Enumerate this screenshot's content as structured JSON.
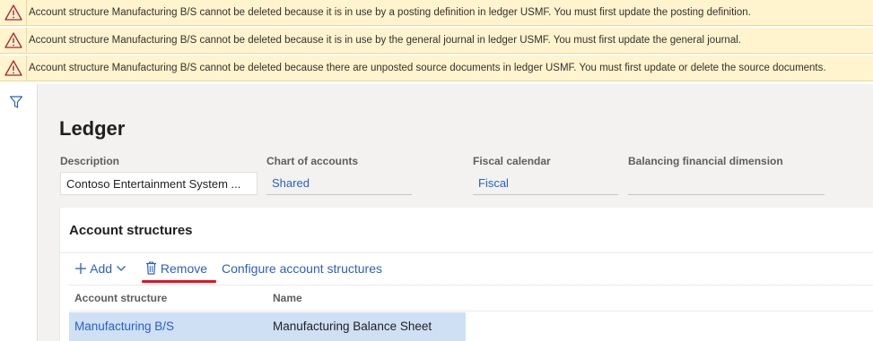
{
  "warnings": [
    "Account structure Manufacturing B/S cannot be deleted because it is in use by a posting definition in ledger USMF. You must first update the posting definition.",
    "Account structure Manufacturing B/S cannot be deleted because it is in use by the general journal in ledger USMF. You must first update the general journal.",
    "Account structure Manufacturing B/S cannot be deleted because there are unposted source documents in ledger USMF. You must first update or delete the source documents."
  ],
  "page": {
    "title": "Ledger"
  },
  "fields": {
    "description": {
      "label": "Description",
      "value": "Contoso Entertainment System ..."
    },
    "chart_of_accounts": {
      "label": "Chart of accounts",
      "value": "Shared"
    },
    "fiscal_calendar": {
      "label": "Fiscal calendar",
      "value": "Fiscal"
    },
    "balancing_dimension": {
      "label": "Balancing financial dimension",
      "value": ""
    }
  },
  "account_structures": {
    "title": "Account structures",
    "toolbar": {
      "add": "Add",
      "remove": "Remove",
      "configure": "Configure account structures"
    },
    "columns": [
      "Account structure",
      "Name"
    ],
    "rows": [
      {
        "account_structure": "Manufacturing B/S",
        "name": "Manufacturing Balance Sheet"
      }
    ]
  },
  "colors": {
    "warning_bg": "#fff4ce",
    "link": "#2b5fc4",
    "selected_row": "#cfe0f5",
    "highlight": "#e81123"
  }
}
